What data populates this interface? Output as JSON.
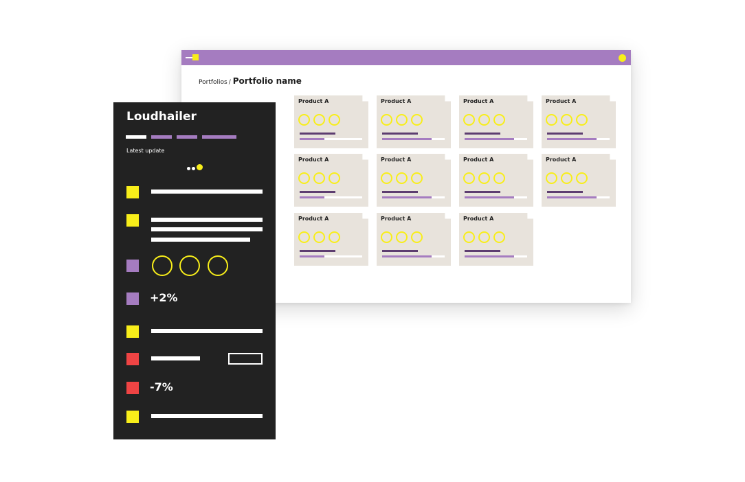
{
  "colors": {
    "purple": "#a57cc0",
    "dark_purple": "#5d3d70",
    "yellow": "#f8ee1a",
    "red": "#ef4444",
    "panel_bg": "#222222",
    "card_bg": "#e8e3dc"
  },
  "window": {
    "menu_icon": "menu-icon",
    "status_icon": "yellow-dot-icon"
  },
  "breadcrumb": {
    "root": "Portfolios",
    "separator": "/",
    "current": "Portfolio name"
  },
  "products": [
    {
      "title": "Product A",
      "progress": 0.4
    },
    {
      "title": "Product A",
      "progress": 0.79
    },
    {
      "title": "Product A",
      "progress": 0.79
    },
    {
      "title": "Product A",
      "progress": 0.79
    },
    {
      "title": "Product A",
      "progress": 0.4
    },
    {
      "title": "Product A",
      "progress": 0.79
    },
    {
      "title": "Product A",
      "progress": 0.79
    },
    {
      "title": "Product A",
      "progress": 0.79
    },
    {
      "title": "Product A",
      "progress": 0.4
    },
    {
      "title": "Product A",
      "progress": 0.79
    },
    {
      "title": "Product A",
      "progress": 0.79
    }
  ],
  "panel": {
    "brand": "Loudhailer",
    "latest_update": "Latest update",
    "metric_up": "+2%",
    "metric_down": "-7%"
  }
}
